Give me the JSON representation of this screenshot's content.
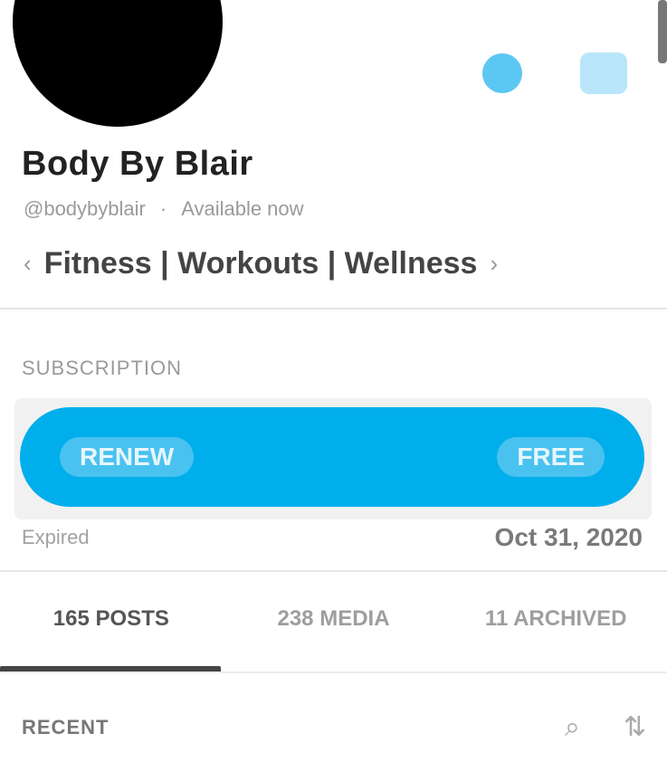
{
  "profile": {
    "name": "Body By Blair",
    "handle": "@bodybyblair",
    "status": "Available now"
  },
  "chips": {
    "prev_icon": "chevron-left-icon",
    "label": "Fitness | Workouts | Wellness",
    "next_icon": "chevron-right-icon"
  },
  "subscription": {
    "section_label": "SUBSCRIPTION",
    "button_left": "RENEW",
    "button_right": "FREE",
    "expired_label": "Expired",
    "expired_date": "Oct 31, 2020"
  },
  "tabs": [
    {
      "label": "165 POSTS"
    },
    {
      "label": "238 MEDIA"
    },
    {
      "label": "11 ARCHIVED"
    }
  ],
  "sort": {
    "label": "RECENT",
    "search_icon": "search-icon",
    "sort_icon": "sort-icon"
  },
  "colors": {
    "accent": "#00AEEC",
    "accent_light": "#5CC7F2",
    "accent_pale": "#B9E6FA"
  }
}
